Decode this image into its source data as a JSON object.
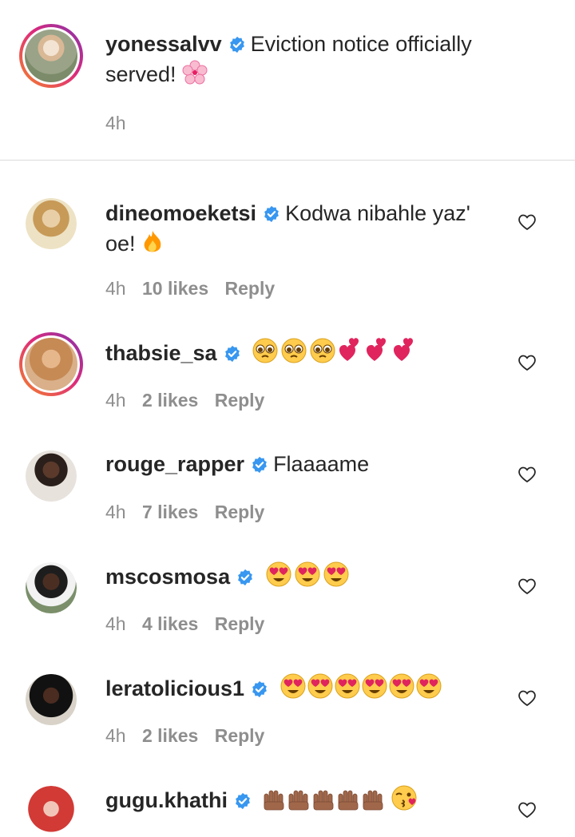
{
  "caption": {
    "username": "yonessalvv",
    "text": "Eviction notice officially served!",
    "emoji": "cherry-blossom",
    "time": "4h"
  },
  "comments": [
    {
      "username": "dineomoeketsi",
      "text": "Kodwa nibahle yaz' oe!",
      "emoji": "fire",
      "time": "4h",
      "likes": "10 likes",
      "reply": "Reply"
    },
    {
      "username": "thabsie_sa",
      "text": "",
      "emoji": "pleading-faces-and-two-hearts",
      "time": "4h",
      "likes": "2 likes",
      "reply": "Reply"
    },
    {
      "username": "rouge_rapper",
      "text": "Flaaaame",
      "emoji": "",
      "time": "4h",
      "likes": "7 likes",
      "reply": "Reply"
    },
    {
      "username": "mscosmosa",
      "text": "",
      "emoji": "heart-eyes-x3",
      "time": "4h",
      "likes": "4 likes",
      "reply": "Reply"
    },
    {
      "username": "leratolicious1",
      "text": "",
      "emoji": "heart-eyes-x6",
      "time": "4h",
      "likes": "2 likes",
      "reply": "Reply"
    },
    {
      "username": "gugu.khathi",
      "text": "",
      "emoji": "raised-hands-x5-kiss",
      "time": "",
      "likes": "",
      "reply": ""
    }
  ],
  "colors": {
    "verified": "#3897f0",
    "meta_text": "#8e8e8e",
    "divider": "#dbdbdb",
    "story_ring_start": "#f58529",
    "story_ring_end": "#8134af"
  },
  "icons": [
    "verified-badge-icon",
    "heart-outline-icon"
  ]
}
